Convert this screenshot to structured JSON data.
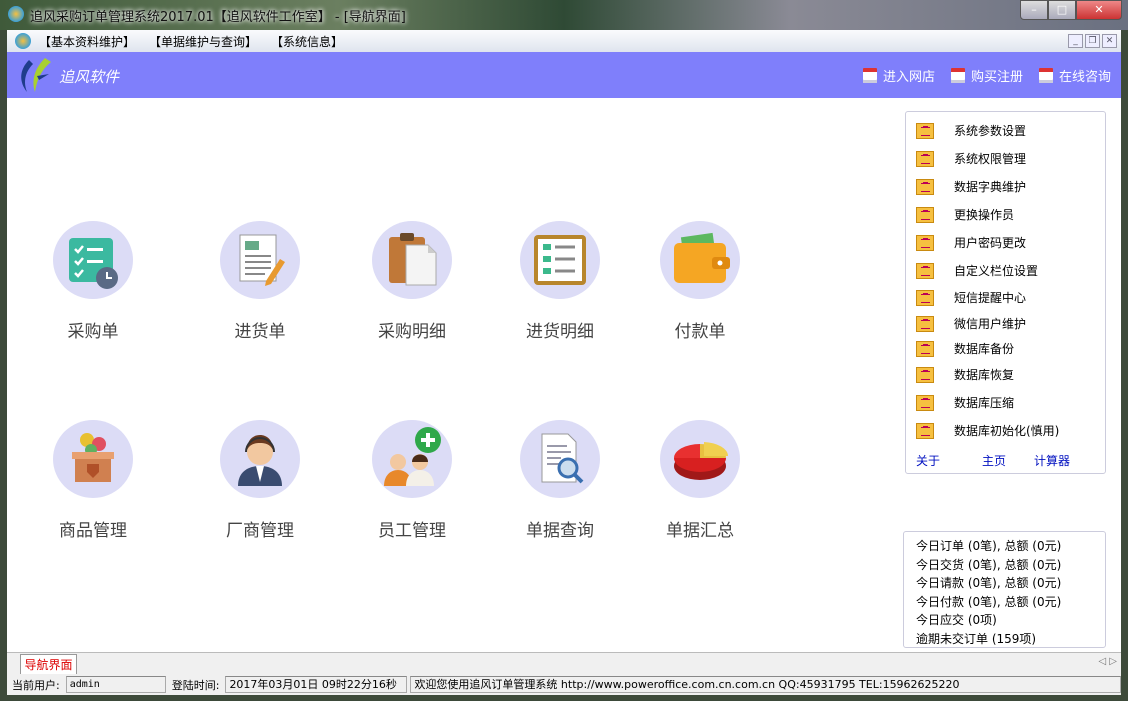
{
  "window": {
    "title": "追风采购订单管理系统2017.01【追风软件工作室】 - [导航界面]",
    "min": "–",
    "max": "□",
    "close": "✕"
  },
  "menu": [
    "【基本资料维护】",
    "【单据维护与查询】",
    "【系统信息】"
  ],
  "mdi": {
    "min": "_",
    "restore": "❐",
    "close": "✕"
  },
  "banner": {
    "brand": "追风软件",
    "links": [
      "进入网店",
      "购买注册",
      "在线咨询"
    ],
    "accent": "#7f7ffb"
  },
  "nav": [
    {
      "label": "采购单",
      "icon": "checklist-clock-icon"
    },
    {
      "label": "进货单",
      "icon": "document-pen-icon"
    },
    {
      "label": "采购明细",
      "icon": "clipboard-icon"
    },
    {
      "label": "进货明细",
      "icon": "list-board-icon"
    },
    {
      "label": "付款单",
      "icon": "wallet-icon"
    },
    {
      "label": "商品管理",
      "icon": "goods-box-icon"
    },
    {
      "label": "厂商管理",
      "icon": "support-agent-icon"
    },
    {
      "label": "员工管理",
      "icon": "add-user-icon"
    },
    {
      "label": "单据查询",
      "icon": "document-search-icon"
    },
    {
      "label": "单据汇总",
      "icon": "pie-chart-icon"
    }
  ],
  "side": {
    "items": [
      "系统参数设置",
      "系统权限管理",
      "数据字典维护",
      "更换操作员",
      "用户密码更改",
      "自定义栏位设置",
      "短信提醒中心",
      "微信用户维护",
      "数据库备份",
      "数据库恢复",
      "数据库压缩",
      "数据库初始化(慎用)"
    ],
    "links": [
      "关于",
      "主页",
      "计算器"
    ]
  },
  "stats": [
    "今日订单 (0笔), 总额 (0元)",
    "今日交货 (0笔), 总额 (0元)",
    "今日请款 (0笔), 总额 (0元)",
    "今日付款 (0笔), 总额 (0元)",
    "今日应交 (0项)",
    "逾期未交订单 (159项)"
  ],
  "tab": "导航界面",
  "status": {
    "user_label": "当前用户:",
    "user": "admin",
    "login_label": "登陆时间:",
    "login": "2017年03月01日 09时22分16秒",
    "welcome": "欢迎您使用追风订单管理系统 http://www.poweroffice.com.cn.com.cn QQ:45931795 TEL:15962625220"
  }
}
